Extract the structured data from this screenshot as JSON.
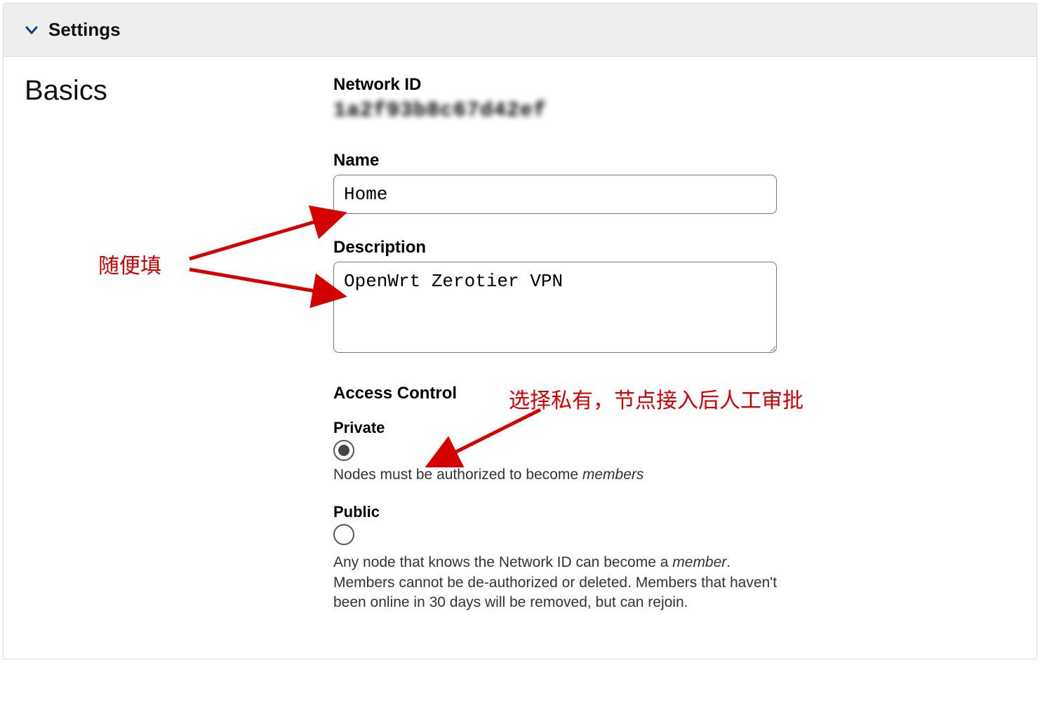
{
  "header": {
    "title": "Settings"
  },
  "basics": {
    "section_title": "Basics",
    "network_id_label": "Network ID",
    "network_id_value": "1a2f93b8c67d42ef",
    "name_label": "Name",
    "name_value": "Home",
    "description_label": "Description",
    "description_value": "OpenWrt Zerotier VPN",
    "access_control_label": "Access Control",
    "private": {
      "label": "Private",
      "help_prefix": "Nodes must be authorized to become ",
      "help_em": "members"
    },
    "public": {
      "label": "Public",
      "help_prefix": "Any node that knows the Network ID can become a ",
      "help_em": "member",
      "help_suffix": ". Members cannot be de-authorized or deleted. Members that haven't been online in 30 days will be removed, but can rejoin."
    }
  },
  "annotations": {
    "fill_any": "随便填",
    "choose_private": "选择私有，节点接入后人工审批"
  }
}
